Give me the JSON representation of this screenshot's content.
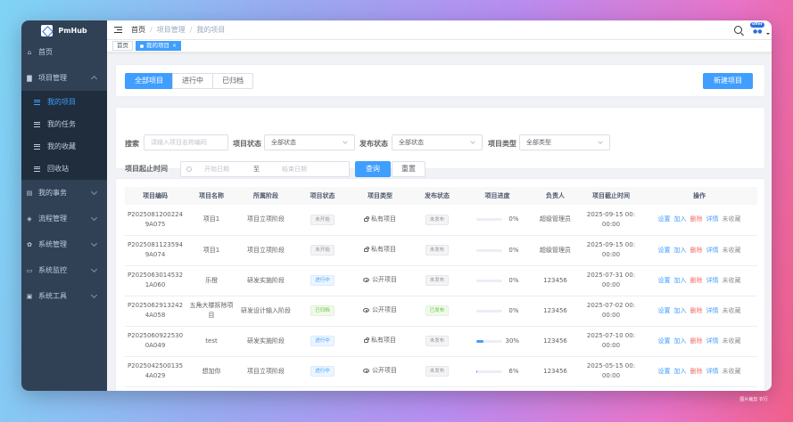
{
  "app": {
    "name": "PmHub"
  },
  "colors": {
    "sidebar": "#304156",
    "accent": "#409eff",
    "danger": "#f56c6c"
  },
  "sidebar": {
    "items": [
      {
        "label": "首页",
        "icon": "home-icon"
      },
      {
        "label": "项目管理",
        "icon": "folder-icon",
        "expanded": true,
        "children": [
          {
            "label": "我的项目",
            "active": true
          },
          {
            "label": "我的任务"
          },
          {
            "label": "我的收藏"
          },
          {
            "label": "回收站"
          }
        ]
      },
      {
        "label": "我的事务",
        "icon": "document-icon"
      },
      {
        "label": "流程管理",
        "icon": "flow-icon"
      },
      {
        "label": "系统管理",
        "icon": "gear-icon"
      },
      {
        "label": "系统监控",
        "icon": "monitor-icon"
      },
      {
        "label": "系统工具",
        "icon": "toolbox-icon"
      }
    ]
  },
  "navbar": {
    "breadcrumb": [
      "首页",
      "项目管理",
      "我的项目"
    ],
    "avatar_badge": "offer"
  },
  "tags": {
    "home": "首页",
    "current": "我的项目"
  },
  "toolbar": {
    "tabs": [
      "全部项目",
      "进行中",
      "已归档"
    ],
    "new_button": "新建项目"
  },
  "filters": {
    "search_label": "搜索",
    "search_placeholder": "请输入项目名称编码",
    "status_label": "项目状态",
    "status_value": "全部状态",
    "publish_label": "发布状态",
    "publish_value": "全部状态",
    "type_label": "项目类型",
    "type_value": "全部类型",
    "time_label": "项目起止时间",
    "start_placeholder": "开始日期",
    "range_sep": "至",
    "end_placeholder": "结束日期",
    "query_button": "查询",
    "reset_button": "重置"
  },
  "table": {
    "headers": [
      "项目编码",
      "项目名称",
      "所属阶段",
      "项目状态",
      "项目类型",
      "发布状态",
      "项目进度",
      "负责人",
      "项目截止时间",
      "操作"
    ],
    "rows": [
      {
        "code": "P20250812002249A075",
        "name": "项目1",
        "stage": "项目立项阶段",
        "status": "未开始",
        "status_kind": "gray",
        "type": "私有项目",
        "type_icon": "lock-icon",
        "publish": "未发布",
        "publish_kind": "gray",
        "progress": 0,
        "progress_label": "0%",
        "owner": "超级管理员",
        "deadline": "2025-09-15 00:00:00"
      },
      {
        "code": "P20250811235949A074",
        "name": "项目1",
        "stage": "项目立项阶段",
        "status": "未开始",
        "status_kind": "gray",
        "type": "私有项目",
        "type_icon": "lock-icon",
        "publish": "未发布",
        "publish_kind": "gray",
        "progress": 0,
        "progress_label": "0%",
        "owner": "超级管理员",
        "deadline": "2025-09-15 00:00:00"
      },
      {
        "code": "P20250630145321A060",
        "name": "乐橙",
        "stage": "研发实施阶段",
        "status": "进行中",
        "status_kind": "blue",
        "type": "公开项目",
        "type_icon": "eye-icon",
        "publish": "未发布",
        "publish_kind": "gray",
        "progress": 0,
        "progress_label": "0%",
        "owner": "123456",
        "deadline": "2025-07-31 00:00:00"
      },
      {
        "code": "P20250629132424A058",
        "name": "五角大楼拆除项目",
        "stage": "研发设计输入阶段",
        "status": "已归档",
        "status_kind": "green",
        "type": "公开项目",
        "type_icon": "eye-icon",
        "publish": "已发布",
        "publish_kind": "green",
        "progress": 0,
        "progress_label": "0%",
        "owner": "123456",
        "deadline": "2025-07-02 00:00:00"
      },
      {
        "code": "P20250609225300A049",
        "name": "test",
        "stage": "研发实施阶段",
        "status": "进行中",
        "status_kind": "blue",
        "type": "私有项目",
        "type_icon": "lock-icon",
        "publish": "未发布",
        "publish_kind": "gray",
        "progress": 30,
        "progress_label": "30%",
        "owner": "123456",
        "deadline": "2025-07-10 00:00:00"
      },
      {
        "code": "P20250425001354A029",
        "name": "想加你",
        "stage": "项目立项阶段",
        "status": "进行中",
        "status_kind": "blue",
        "type": "公开项目",
        "type_icon": "eye-icon",
        "publish": "未发布",
        "publish_kind": "gray",
        "progress": 6,
        "progress_label": "6%",
        "owner": "123456",
        "deadline": "2025-05-15 00:00:00"
      }
    ],
    "actions": [
      "设置",
      "加入",
      "删除",
      "详情",
      "未收藏"
    ]
  },
  "watermark": "图片裁剪 农行"
}
